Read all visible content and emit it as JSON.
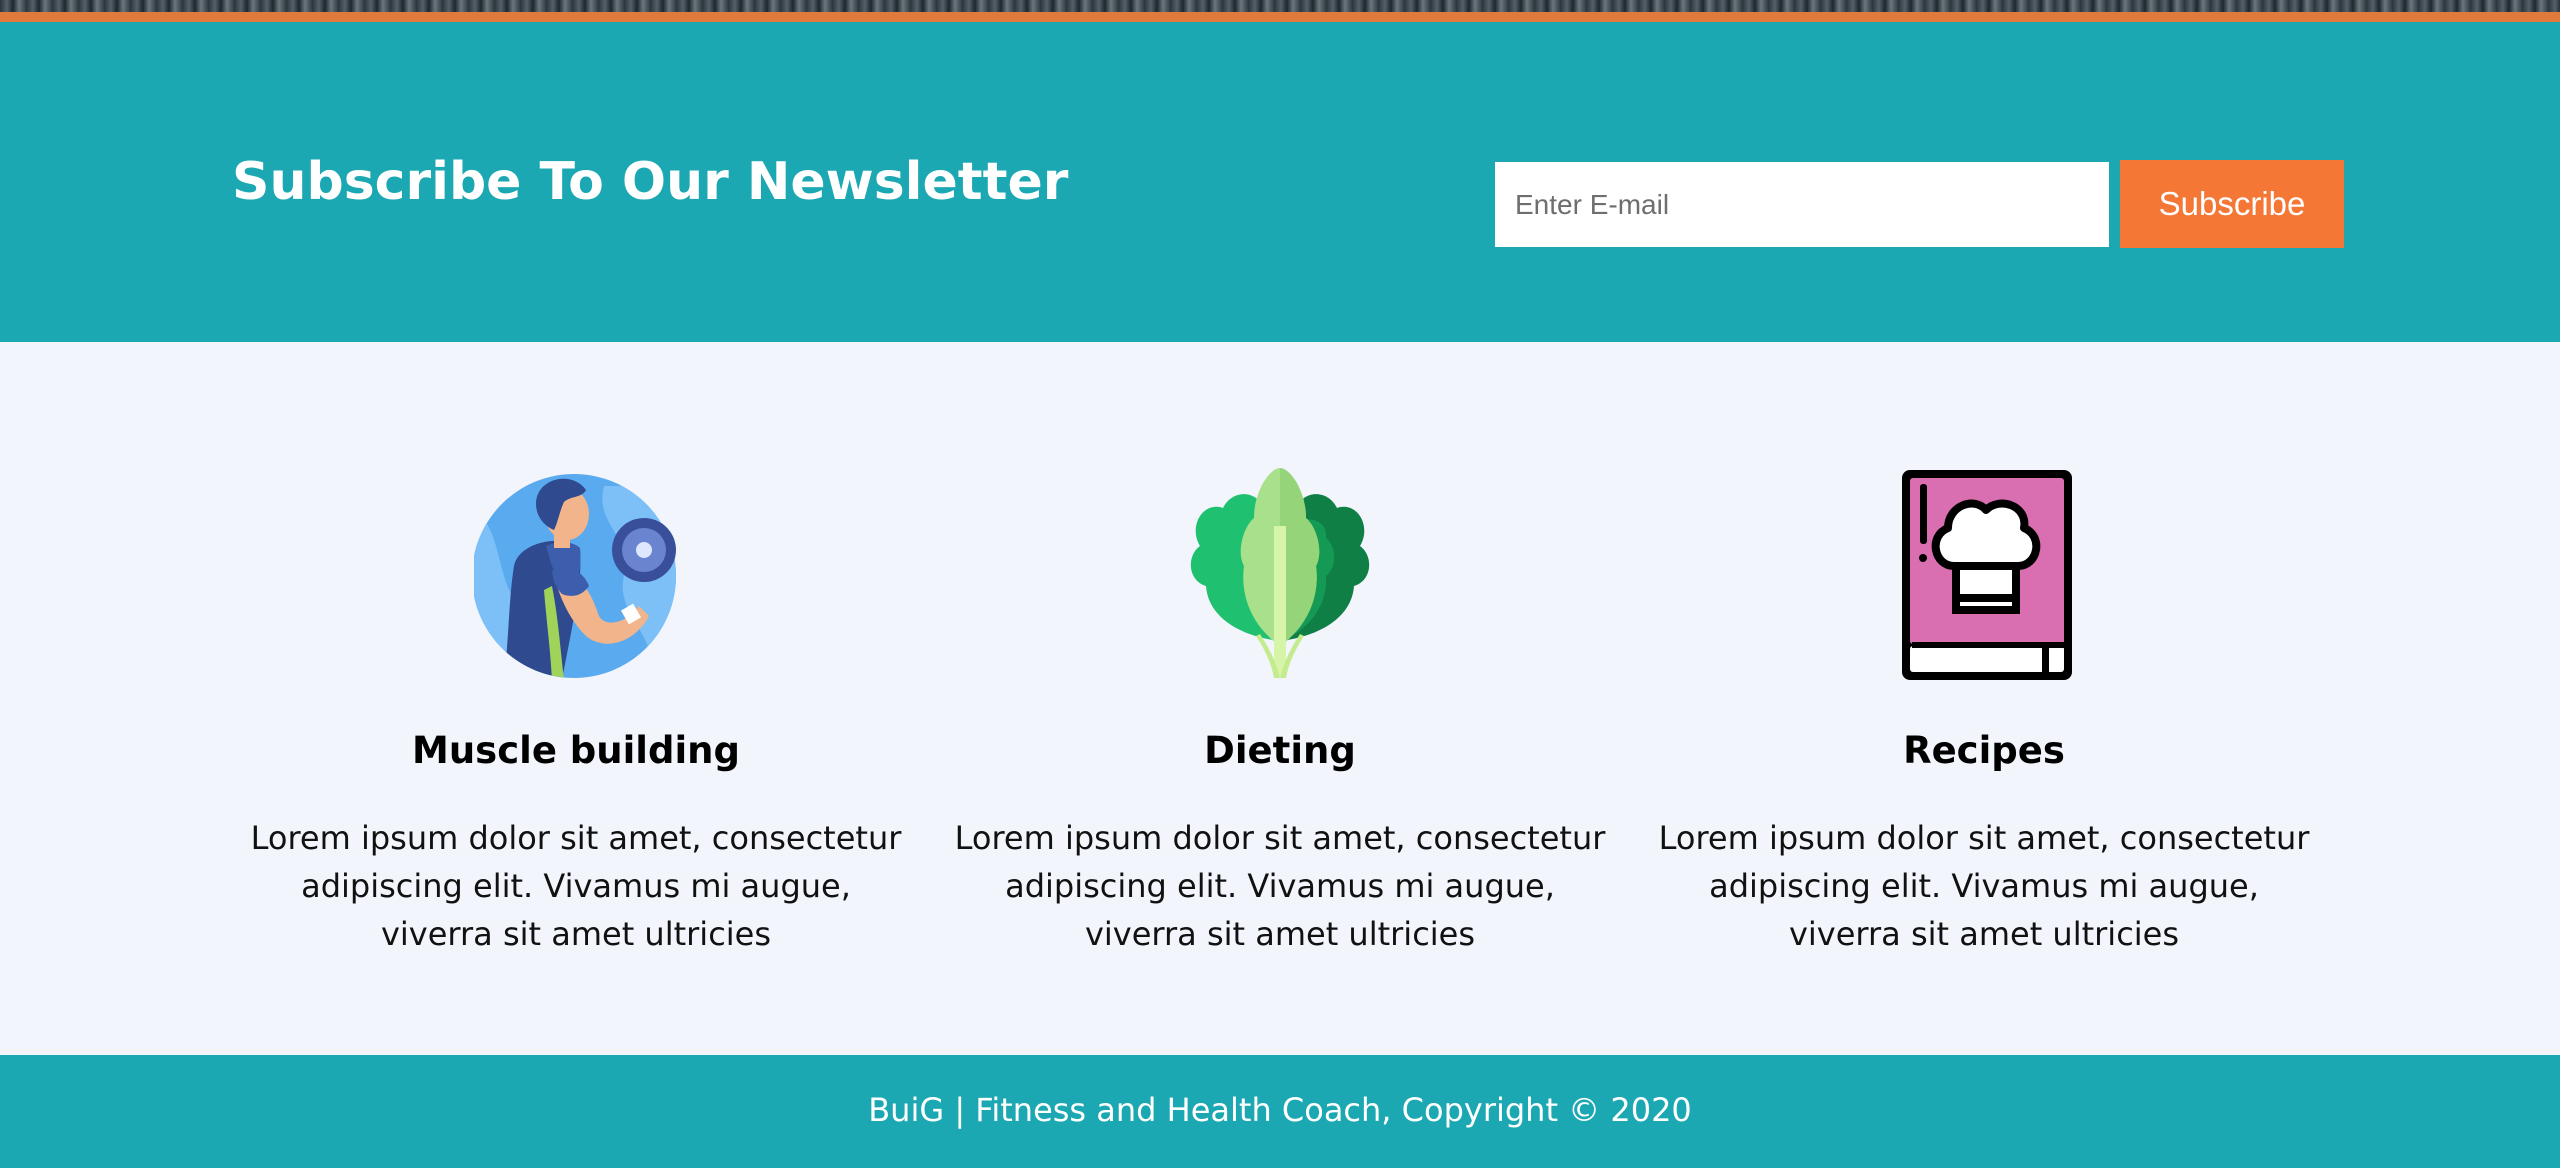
{
  "newsletter": {
    "title": "Subscribe To Our Newsletter",
    "email_placeholder": "Enter E-mail",
    "email_value": "",
    "subscribe_label": "Subscribe"
  },
  "features": [
    {
      "icon": "muscle-building-icon",
      "title": "Muscle building",
      "text": "Lorem ipsum dolor sit amet, consectetur adipiscing elit. Vivamus mi augue, viverra sit amet ultricies"
    },
    {
      "icon": "lettuce-icon",
      "title": "Dieting",
      "text": "Lorem ipsum dolor sit amet, consectetur adipiscing elit. Vivamus mi augue, viverra sit amet ultricies"
    },
    {
      "icon": "recipe-book-icon",
      "title": "Recipes",
      "text": "Lorem ipsum dolor sit amet, consectetur adipiscing elit. Vivamus mi augue, viverra sit amet ultricies"
    }
  ],
  "footer": {
    "text": "BuiG | Fitness and Health Coach, Copyright © 2020"
  },
  "colors": {
    "teal": "#1ba8b2",
    "orange": "#f47735",
    "background": "#f2f5fc"
  }
}
